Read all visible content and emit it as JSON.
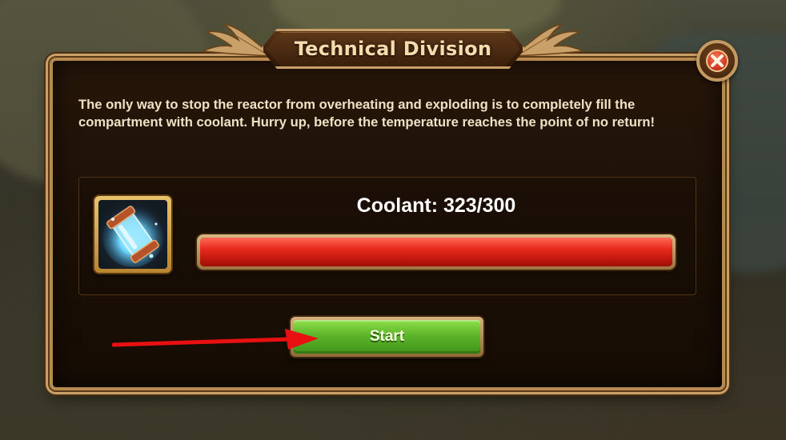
{
  "dialog": {
    "title": "Technical Division",
    "description": "The only way to stop the reactor from overheating and exploding is to completely fill the compartment with coolant. Hurry up, before the temperature reaches the point of no return!"
  },
  "coolant": {
    "label": "Coolant: 323/300",
    "current": 323,
    "max": 300,
    "fill_fraction": 1.0,
    "bar_color": "#e0271b"
  },
  "item": {
    "icon": "coolant-canister-icon"
  },
  "actions": {
    "start_label": "Start",
    "start_color": "#5db52a"
  },
  "close": {
    "icon": "close-icon"
  },
  "annotation": {
    "arrow_color": "#e81010"
  }
}
